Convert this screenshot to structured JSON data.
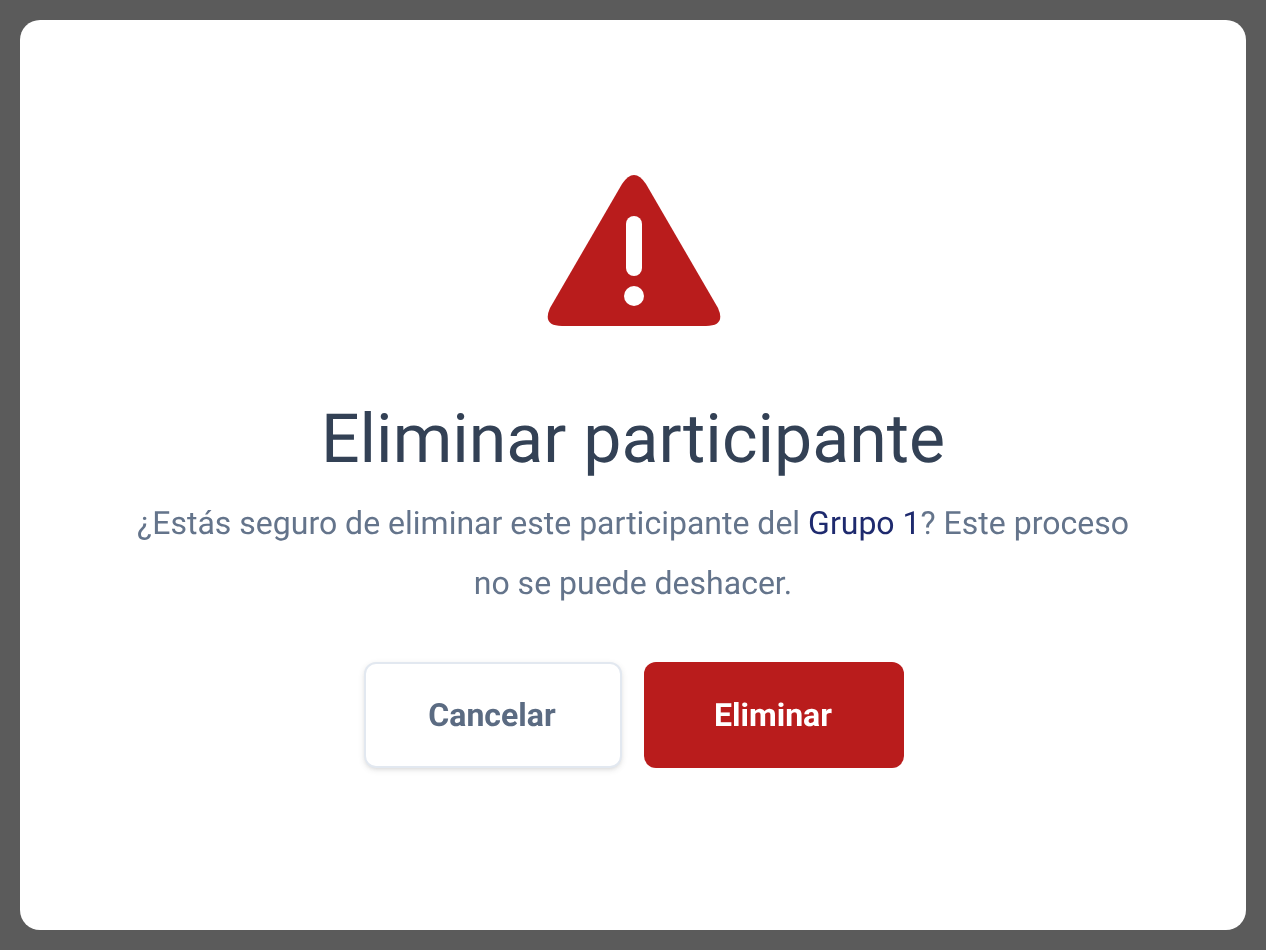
{
  "dialog": {
    "title": "Eliminar participante",
    "message": [
      {
        "kind": "text",
        "text": "¿Estás seguro de eliminar este participante del "
      },
      {
        "kind": "link",
        "text": "Grupo 1"
      },
      {
        "kind": "text",
        "text": "? Este proceso no se puede deshacer."
      }
    ],
    "buttons": [
      {
        "label": "Cancelar",
        "kind": "secondary"
      },
      {
        "label": "Eliminar",
        "kind": "danger"
      }
    ]
  }
}
